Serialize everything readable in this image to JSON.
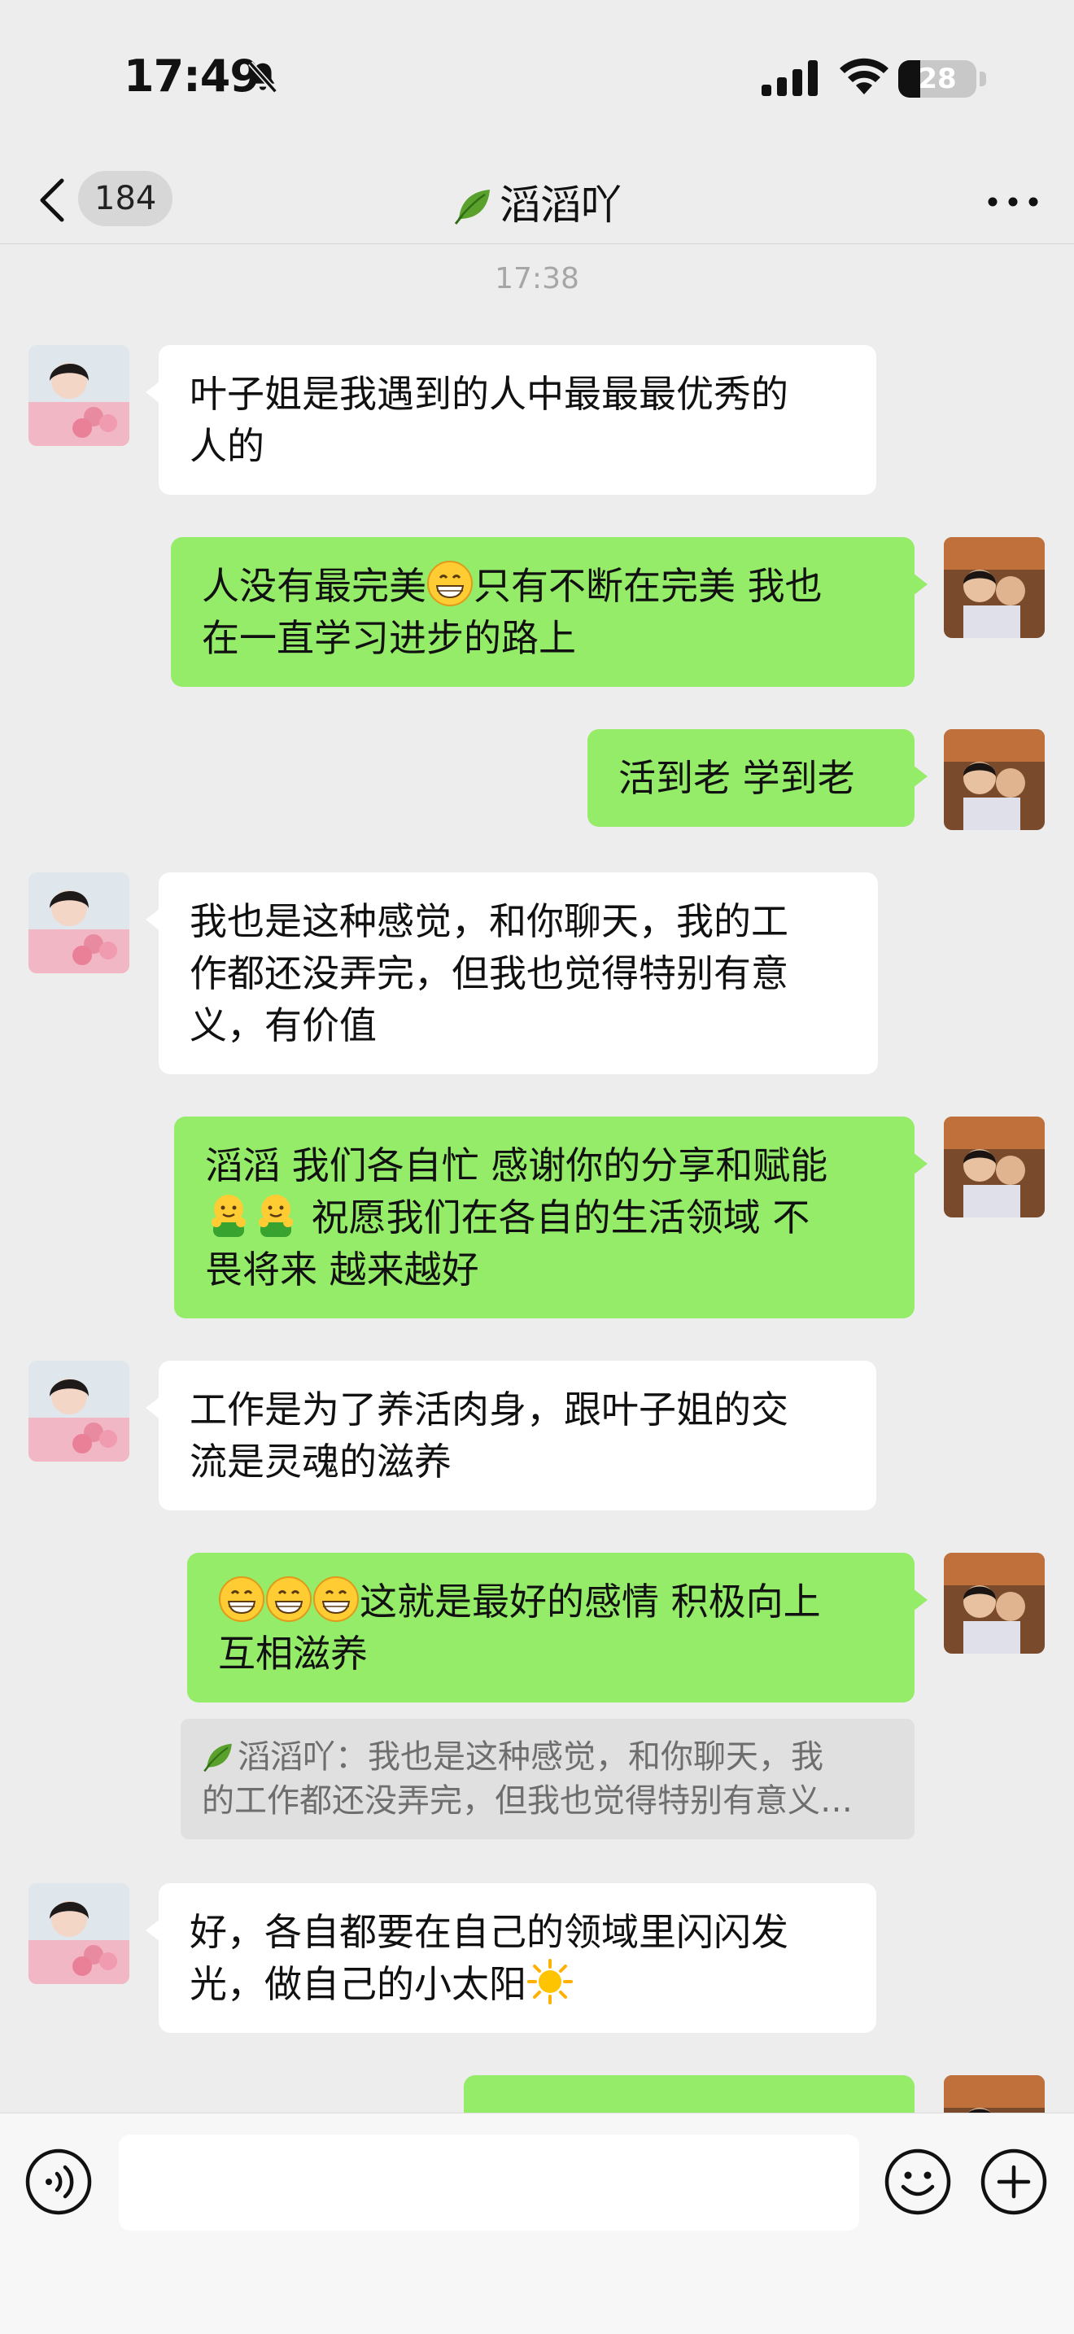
{
  "status_bar": {
    "time": "17:49",
    "battery": "28",
    "battery_level": 0.28
  },
  "nav": {
    "back_count": "184",
    "title": "滔滔吖"
  },
  "chat": {
    "timestamp": "17:38",
    "messages": [
      {
        "side": "in",
        "lines": [
          "叶子姐是我遇到的人中最最最优秀的",
          "人的"
        ]
      },
      {
        "side": "out",
        "line1_before": "人没有最完美",
        "line1_after": "只有不断在完美 我也",
        "line2": "在一直学习进步的路上"
      },
      {
        "side": "out",
        "lines": [
          "活到老 学到老"
        ]
      },
      {
        "side": "in",
        "lines": [
          "我也是这种感觉，和你聊天，我的工",
          "作都还没弄完，但我也觉得特别有意",
          "义，有价值"
        ]
      },
      {
        "side": "out",
        "line1": "滔滔 我们各自忙 感谢你的分享和赋能",
        "line2_after": " 祝愿我们在各自的生活领域 不",
        "line3": "畏将来 越来越好"
      },
      {
        "side": "in",
        "lines": [
          "工作是为了养活肉身，跟叶子姐的交",
          "流是灵魂的滋养"
        ]
      },
      {
        "side": "out",
        "line1_after": "这就是最好的感情 积极向上",
        "line2": "互相滋养"
      },
      {
        "side": "in",
        "line1": "好，各自都要在自己的领域里闪闪发",
        "line2_before": "光，做自己的小太阳"
      }
    ],
    "quote": {
      "line1": "滔滔吖：我也是这种感觉，和你聊天，我",
      "line2": "的工作都还没弄完，但我也觉得特别有意义…"
    }
  },
  "input": {
    "placeholder": ""
  },
  "colors": {
    "outgoing_bubble": "#95ec69",
    "incoming_bubble": "#ffffff",
    "background": "#ededed"
  },
  "icons": [
    "bell-slash-icon",
    "signal-icon",
    "wifi-icon",
    "battery-icon",
    "back-chevron-icon",
    "leaf-icon",
    "more-icon",
    "grin-emoji",
    "hug-emoji",
    "sun-emoji",
    "voice-icon",
    "emoji-icon",
    "plus-icon"
  ]
}
